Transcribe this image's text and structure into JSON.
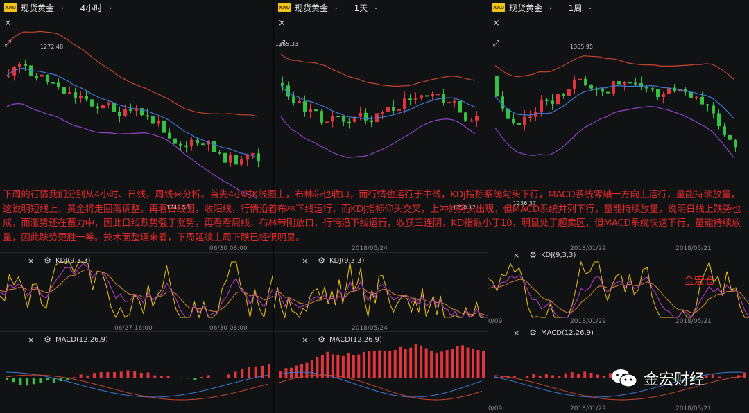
{
  "panels": [
    {
      "symbol_badge": "XAU",
      "instrument": "现货黄金",
      "timeframe": "4小时",
      "price_labels": [
        "1272.48",
        "1245.50"
      ],
      "date_labels_main": [
        "06/30 08:00"
      ],
      "date_labels_kdj": [
        "06/27 16:00",
        "06/30 08:00"
      ],
      "kdj_label": "KDJ(9,3,3)",
      "macd_label": "MACD(12,26,9)"
    },
    {
      "symbol_badge": "XAU",
      "instrument": "现货黄金",
      "timeframe": "1天",
      "price_labels": [
        "1365.33",
        "1250.12"
      ],
      "date_labels_main": [
        "2018/05/24"
      ],
      "date_labels_kdj": [
        "2018/05/24"
      ],
      "kdj_label": "KDJ(9,3,3)",
      "macd_label": "MACD(12,26,9)"
    },
    {
      "symbol_badge": "XAU",
      "instrument": "现货黄金",
      "timeframe": "1周",
      "price_labels": [
        "1365.95",
        "1236.37"
      ],
      "date_labels_main": [
        "2018/01/29",
        "2018/05/21"
      ],
      "date_labels_kdj": [
        "0/09",
        "2018/01/29",
        "2018/05/21"
      ],
      "date_labels_macd": [
        "0/09",
        "2018/01/29",
        "2018/05/21"
      ],
      "kdj_label": "KDJ(9,3,3)",
      "macd_label": "MACD(12,26,9)"
    }
  ],
  "icons": {
    "close": "×",
    "gear": "⚙",
    "expand": "⤢",
    "chevron": "⌄"
  },
  "colors": {
    "up": "#e0353c",
    "down": "#35c244",
    "bb_upper": "#c8462e",
    "bb_mid": "#3f79d6",
    "bb_lower": "#8f45cc",
    "kdj_k": "#f5c518",
    "kdj_d": "#d98b2b",
    "kdj_j": "#c13fd0",
    "overlay_text": "#e32a2a"
  },
  "analysis_text": "下周的行情我们分别从4小时、日线，周线来分析。首先4小时K线图上，布林带也收口，而行情也运行于中线，KDj指标系统勾头下行，MACD系统零轴一方向上运行，量能持续放量，这说明短线上，黄金将走回落调整。再看日线图，收阳线，行情沿着布林下线运行，而KDJ指标仰头交叉，上冲的势头出现，但MACD系统并列下行，量能持续放量，说明日线上跌势也成，而涨势还在蓄力中，因此日线跌势强于涨势。再看看周线，布林带刚放口，行情沿下线运行，收获三连阴，KD指数小于10，明显处于超卖区，但MACD系统快速下行，量能持续放量，因此跌势更胜一筹。技术面整理来看，下周延续上周下跌已经很明显。",
  "watermark_name": "金宏仓",
  "brand_name": "金宏财经"
}
